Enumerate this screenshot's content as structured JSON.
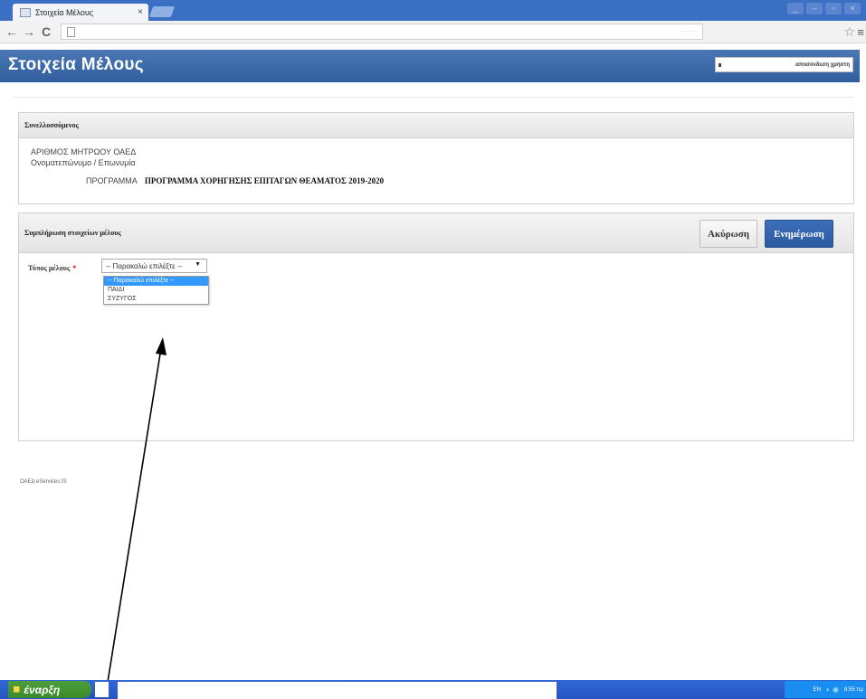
{
  "browser": {
    "tab_title": "Στοιχεία Μέλους",
    "tab_close": "×",
    "nav": {
      "back": "←",
      "forward": "→",
      "reload": "C"
    },
    "omnibox_right": "·········",
    "star": "☆",
    "menu": "≡",
    "window_controls": [
      "_",
      "–",
      "▫",
      "×"
    ]
  },
  "app": {
    "title": "Στοιχεία Μέλους",
    "user_menu": "αποσύνδεση χρήστη"
  },
  "panel_member": {
    "heading": "Συνελλοσσόμενος",
    "rows": [
      {
        "label": "ΑΡΙΘΜΟΣ ΜΗΤΡΩΟΥ ΟΑΕΔ",
        "value": ""
      },
      {
        "label": "Ονοματεπώνυμο / Επωνυμία",
        "value": ""
      },
      {
        "label": "ΠΡΟΓΡΑΜΜΑ",
        "value": "ΠΡΟΓΡΑΜΜΑ ΧΟΡΗΓΗΣΗΣ ΕΠΙΤΑΓΩΝ ΘΕΑΜΑΤΟΣ 2019-2020"
      }
    ]
  },
  "panel_form": {
    "heading": "Συμπλήρωση στοιχείων μέλους",
    "cancel_label": "Ακύρωση",
    "update_label": "Ενημέρωση",
    "field_label": "Τύπος μέλους",
    "required_mark": "*",
    "select_value": "-- Παρακαλώ επιλέξτε --",
    "caret": "▼",
    "options": [
      "-- Παρακαλώ επιλέξτε --",
      "ΠΑΙΔΙ",
      "ΣΥΖΥΓΟΣ"
    ],
    "selected_index": 0
  },
  "footer": "ΟΑΕΔ eServices IS",
  "taskbar": {
    "start_label": "έναρξη",
    "lang": "EN",
    "clock": "8:55 πμ"
  },
  "colors": {
    "app_bar": "#3d6aad",
    "update_button": "#2f5fa6",
    "taskbar": "#2b5dcc",
    "start_button": "#449534"
  }
}
